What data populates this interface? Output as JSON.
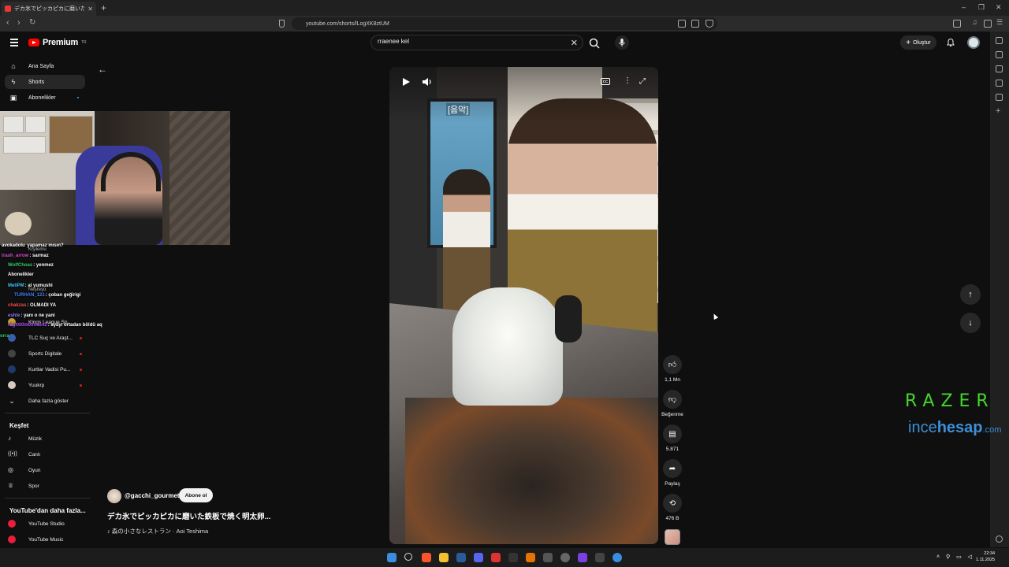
{
  "browser": {
    "tab_title": "デカ氷でピッカピカに磨いた鉄板で焼い",
    "url": "youtube.com/shorts/lLogXK8ztUM"
  },
  "header": {
    "logo_text": "Premium",
    "logo_sup": "TR",
    "search_value": "rraenee kel",
    "create_label": "Oluştur"
  },
  "sidebar": {
    "nav": [
      {
        "label": "Ana Sayfa",
        "icon": "home-icon"
      },
      {
        "label": "Shorts",
        "icon": "shorts-icon"
      },
      {
        "label": "Abonelikler",
        "icon": "subscriptions-icon"
      }
    ],
    "subscriptions": [
      {
        "label": "Kings League Sp...",
        "color": "#c9a227"
      },
      {
        "label": "TLC Suç ve Araşt...",
        "color": "#3a5fb0"
      },
      {
        "label": "Sports Digitale",
        "color": "#444444"
      },
      {
        "label": "Kurtlar Vadisi Pu...",
        "color": "#1f3a6a"
      },
      {
        "label": "Yuukrp",
        "color": "#d8c8c0"
      }
    ],
    "show_more": "Daha fazla göster",
    "explore_title": "Keşfet",
    "explore": [
      {
        "label": "Müzik",
        "icon": "music-icon"
      },
      {
        "label": "Canlı",
        "icon": "live-icon"
      },
      {
        "label": "Oyun",
        "icon": "gaming-icon"
      },
      {
        "label": "Spor",
        "icon": "trophy-icon"
      }
    ],
    "more_title": "YouTube'dan daha fazla...",
    "more": [
      {
        "label": "YouTube Studio"
      },
      {
        "label": "YouTube Music"
      }
    ]
  },
  "chat": [
    {
      "user": "avokadolu",
      "msg": "yapamaz mısın?",
      "color": "#ffffff"
    },
    {
      "user": "Kişilemu",
      "msg": "",
      "color": "#ffffff"
    },
    {
      "user": "trash_arrow",
      "msg": ": sarmaz",
      "color": "#d94fd3"
    },
    {
      "user": "WolfChoas",
      "msg": ": yenmez",
      "color": "#2fcf6a"
    },
    {
      "user": "Abonelikler",
      "msg": "",
      "color": "#ffffff"
    },
    {
      "user": "MeliPM",
      "msg": ": al yumushi",
      "color": "#3fc2ff"
    },
    {
      "user": "TURHAN_121",
      "msg": ": çoban geğirigi",
      "color": "#3f7fff"
    },
    {
      "user": "Neşreşo",
      "msg": "",
      "color": "#ffffff"
    },
    {
      "user": "chakzas",
      "msg": ": OLMADI YA",
      "color": "#ff4f4f"
    },
    {
      "user": "eshle",
      "msg": ": yanı o ne yani",
      "color": "#8a7cff"
    },
    {
      "user": "r1ghtt0m0mfas42",
      "msg": ": ayayı ortadan böldü aq",
      "color": "#b04fff"
    },
    {
      "user": "orra",
      "msg": "",
      "color": "#2fcf6a"
    }
  ],
  "video": {
    "caption": "[음악]",
    "channel": "@gacchi_gourmet",
    "subscribe_label": "Abone ol",
    "title": "デカ氷でピッカピカに磨いた鉄板で焼く明太卵...",
    "music": "♪ 森の小さなレストラン · Aoi Teshima"
  },
  "actions": {
    "likes": "1,1 Mn",
    "dislike_label": "Beğenme",
    "comments": "5.871",
    "share_label": "Paylaş",
    "remixes": "476 B"
  },
  "watermark": {
    "razer": "RAZER",
    "ince": "ince",
    "hesap": "hesap",
    "com": ".com"
  },
  "taskbar": {
    "time": "22:34",
    "date": "1.11.2025"
  }
}
